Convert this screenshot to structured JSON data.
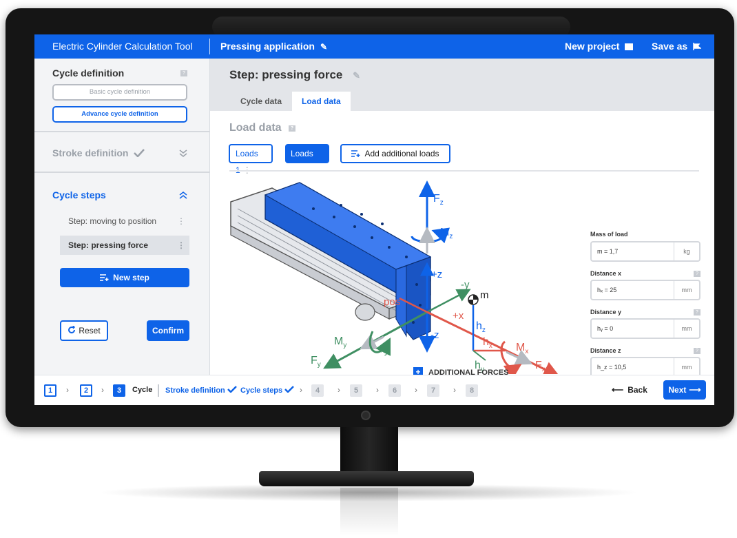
{
  "topbar": {
    "app_title": "Electric Cylinder Calculation Tool",
    "project_name": "Pressing application",
    "new_project": "New project",
    "save_as": "Save as"
  },
  "sidebar": {
    "cycle_definition": "Cycle definition",
    "basic_cycle": "Basic cycle definition",
    "advance_cycle": "Advance cycle definition",
    "stroke_definition": "Stroke definition",
    "cycle_steps": "Cycle steps",
    "steps": [
      {
        "label": "Step: moving to position"
      },
      {
        "label": "Step: pressing force"
      }
    ],
    "new_step": "New step",
    "reset": "Reset",
    "confirm": "Confirm"
  },
  "main": {
    "step_title": "Step: pressing force",
    "tabs": [
      {
        "label": "Cycle data"
      },
      {
        "label": "Load data"
      }
    ],
    "section_title": "Load data",
    "loads": [
      {
        "label": "Loads 1"
      },
      {
        "label": "Loads 2"
      }
    ],
    "add_loads": "Add additional loads",
    "diagram": {
      "fz": "F",
      "fz_sub": "z",
      "mz": "M",
      "mz_sub": "z",
      "plus_z": "+z",
      "minus_y": "-y",
      "m": "m",
      "pos": "pos",
      "plus_x": "+x",
      "hz": "h",
      "hz_sub": "z",
      "my": "M",
      "my_sub": "y",
      "plus_y": "+y",
      "minus_z": "-z",
      "hx": "h",
      "hx_sub": "x",
      "mx": "M",
      "mx_sub": "x",
      "fy": "F",
      "fy_sub": "y",
      "hy": "h",
      "hy_sub": "y",
      "fx": "F",
      "fx_sub": "x"
    },
    "fields": [
      {
        "label": "Mass of load",
        "value": "m = 1,7",
        "unit": "kg"
      },
      {
        "label": "Distance x",
        "value": "hₓ = 25",
        "unit": "mm"
      },
      {
        "label": "Distance y",
        "value": "hᵧ = 0",
        "unit": "mm"
      },
      {
        "label": "Distance z",
        "value": "h_z = 10,5",
        "unit": "mm"
      }
    ],
    "additional_forces": "ADDITIONAL FORCES"
  },
  "footer": {
    "crumbs": [
      "1",
      "2",
      "3"
    ],
    "cycle": "Cycle",
    "stroke_definition": "Stroke definition",
    "cycle_steps": "Cycle steps",
    "disabled": [
      "4",
      "5",
      "6",
      "7",
      "8"
    ],
    "back": "Back",
    "next": "Next"
  },
  "colors": {
    "accent": "#0e63e8",
    "red": "#e0574a",
    "green": "#3f8f62",
    "grey": "#9aa0a8"
  }
}
